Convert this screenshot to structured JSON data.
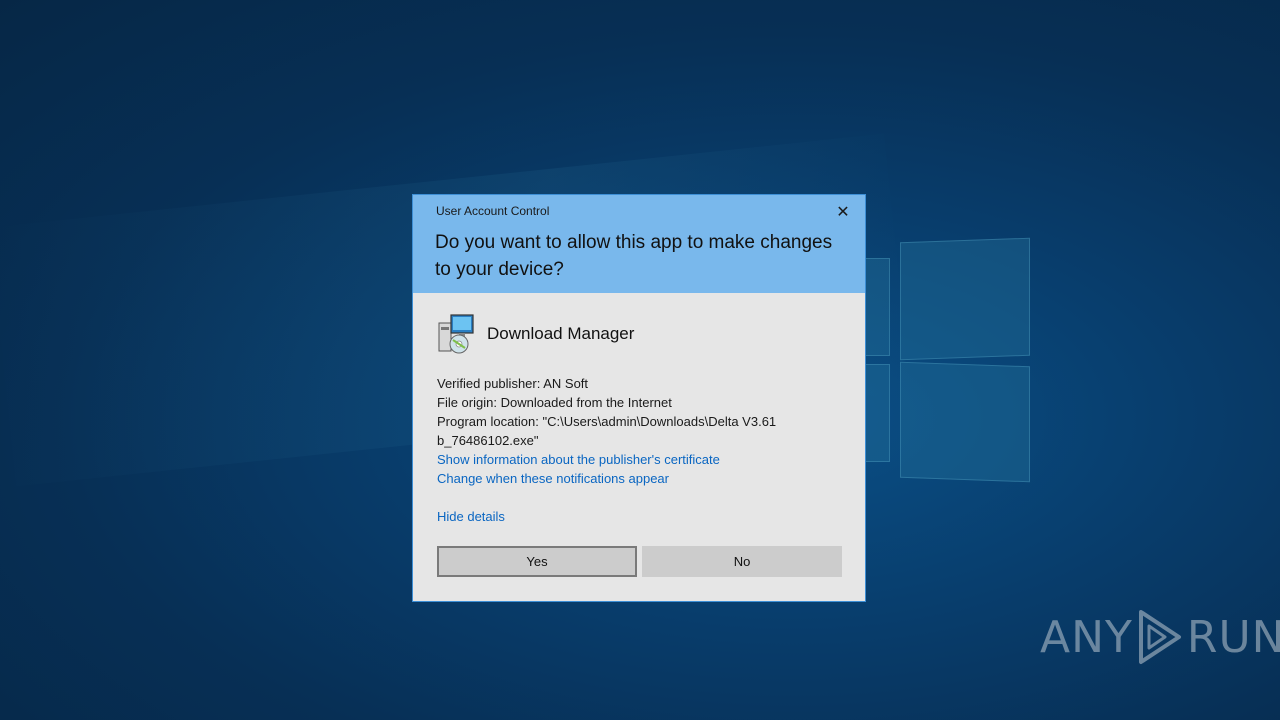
{
  "dialog": {
    "window_title": "User Account Control",
    "close_glyph": "✕",
    "question": "Do you want to allow this app to make changes to your device?",
    "app_name": "Download Manager",
    "app_icon": "installer-icon",
    "publisher": "Verified publisher: AN Soft",
    "file_origin": "File origin: Downloaded from the Internet",
    "program_location_1": "Program location: \"C:\\Users\\admin\\Downloads\\Delta V3.61",
    "program_location_2": "b_76486102.exe\"",
    "cert_link": "Show information about the publisher's certificate",
    "notify_link": "Change when these notifications appear",
    "hide_details": "Hide details",
    "yes_label": "Yes",
    "no_label": "No"
  },
  "watermark": {
    "left": "ANY",
    "right": "RUN"
  },
  "colors": {
    "header": "#79b8ec",
    "body": "#e6e6e6",
    "link": "#0a66c2",
    "desktop": "#083d6c"
  }
}
